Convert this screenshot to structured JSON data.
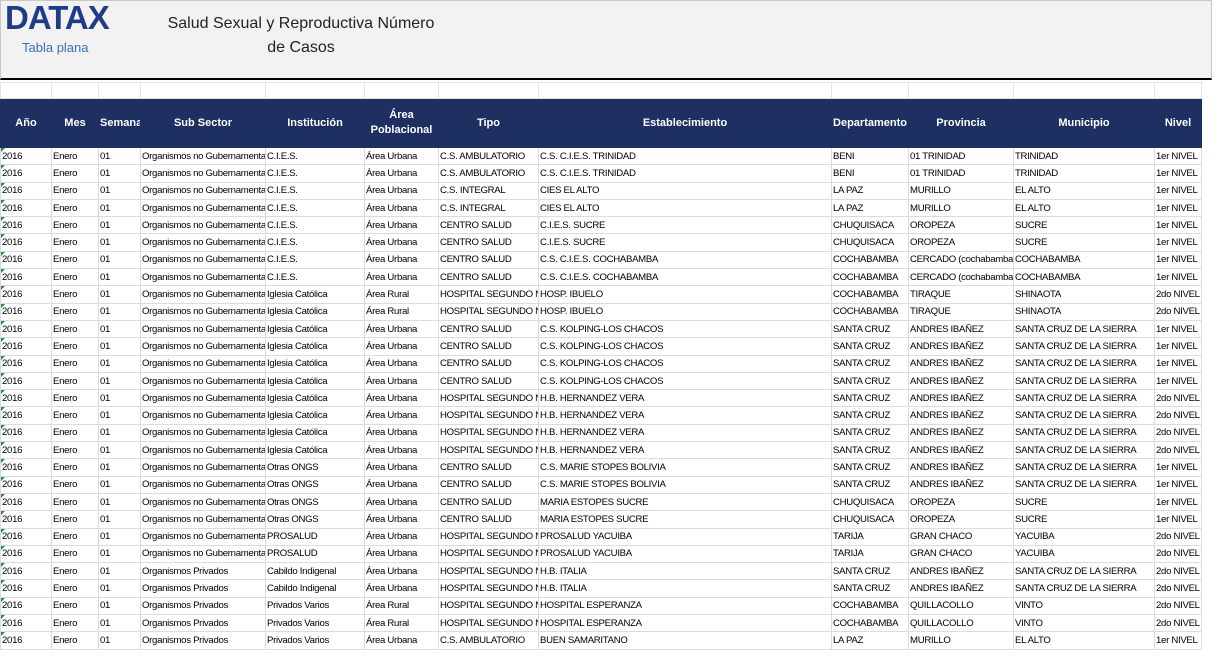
{
  "header": {
    "logo": "DATAX",
    "logo_subtitle": "Tabla plana",
    "title_line1": "Salud Sexual y Reproductiva Número",
    "title_line2": "de Casos"
  },
  "table": {
    "columns": [
      "Año",
      "Mes",
      "Semana",
      "Sub Sector",
      "Institución",
      "Área Poblacional",
      "Tipo",
      "Establecimiento",
      "Departamento",
      "Provincia",
      "Municipio",
      "Nivel"
    ],
    "rows": [
      [
        "2016",
        "Enero",
        "01",
        "Organismos no Gubernamentales",
        "C.I.E.S.",
        "Área Urbana",
        "C.S. AMBULATORIO",
        "C.S. C.I.E.S. TRINIDAD",
        "BENI",
        "01 TRINIDAD",
        "TRINIDAD",
        "1er NIVEL"
      ],
      [
        "2016",
        "Enero",
        "01",
        "Organismos no Gubernamentales",
        "C.I.E.S.",
        "Área Urbana",
        "C.S. AMBULATORIO",
        "C.S. C.I.E.S. TRINIDAD",
        "BENI",
        "01 TRINIDAD",
        "TRINIDAD",
        "1er NIVEL"
      ],
      [
        "2016",
        "Enero",
        "01",
        "Organismos no Gubernamentales",
        "C.I.E.S.",
        "Área Urbana",
        "C.S. INTEGRAL",
        "CIES EL ALTO",
        "LA PAZ",
        "MURILLO",
        "EL ALTO",
        "1er NIVEL"
      ],
      [
        "2016",
        "Enero",
        "01",
        "Organismos no Gubernamentales",
        "C.I.E.S.",
        "Área Urbana",
        "C.S. INTEGRAL",
        "CIES EL ALTO",
        "LA PAZ",
        "MURILLO",
        "EL ALTO",
        "1er NIVEL"
      ],
      [
        "2016",
        "Enero",
        "01",
        "Organismos no Gubernamentales",
        "C.I.E.S.",
        "Área Urbana",
        "CENTRO SALUD",
        "C.I.E.S. SUCRE",
        "CHUQUISACA",
        "OROPEZA",
        "SUCRE",
        "1er NIVEL"
      ],
      [
        "2016",
        "Enero",
        "01",
        "Organismos no Gubernamentales",
        "C.I.E.S.",
        "Área Urbana",
        "CENTRO SALUD",
        "C.I.E.S. SUCRE",
        "CHUQUISACA",
        "OROPEZA",
        "SUCRE",
        "1er NIVEL"
      ],
      [
        "2016",
        "Enero",
        "01",
        "Organismos no Gubernamentales",
        "C.I.E.S.",
        "Área Urbana",
        "CENTRO SALUD",
        "C.S. C.I.E.S. COCHABAMBA",
        "COCHABAMBA",
        "CERCADO (cochabamba)",
        "COCHABAMBA",
        "1er NIVEL"
      ],
      [
        "2016",
        "Enero",
        "01",
        "Organismos no Gubernamentales",
        "C.I.E.S.",
        "Área Urbana",
        "CENTRO SALUD",
        "C.S. C.I.E.S. COCHABAMBA",
        "COCHABAMBA",
        "CERCADO (cochabamba)",
        "COCHABAMBA",
        "1er NIVEL"
      ],
      [
        "2016",
        "Enero",
        "01",
        "Organismos no Gubernamentales",
        "Iglesia Católica",
        "Área Rural",
        "HOSPITAL SEGUNDO NIVEL",
        "HOSP. IBUELO",
        "COCHABAMBA",
        "TIRAQUE",
        "SHINAOTA",
        "2do NIVEL"
      ],
      [
        "2016",
        "Enero",
        "01",
        "Organismos no Gubernamentales",
        "Iglesia Católica",
        "Área Rural",
        "HOSPITAL SEGUNDO NIVEL",
        "HOSP. IBUELO",
        "COCHABAMBA",
        "TIRAQUE",
        "SHINAOTA",
        "2do NIVEL"
      ],
      [
        "2016",
        "Enero",
        "01",
        "Organismos no Gubernamentales",
        "Iglesia Católica",
        "Área Urbana",
        "CENTRO SALUD",
        "C.S. KOLPING-LOS CHACOS",
        "SANTA CRUZ",
        "ANDRES IBAÑEZ",
        "SANTA CRUZ DE LA SIERRA",
        "1er NIVEL"
      ],
      [
        "2016",
        "Enero",
        "01",
        "Organismos no Gubernamentales",
        "Iglesia Católica",
        "Área Urbana",
        "CENTRO SALUD",
        "C.S. KOLPING-LOS CHACOS",
        "SANTA CRUZ",
        "ANDRES IBAÑEZ",
        "SANTA CRUZ DE LA SIERRA",
        "1er NIVEL"
      ],
      [
        "2016",
        "Enero",
        "01",
        "Organismos no Gubernamentales",
        "Iglesia Católica",
        "Área Urbana",
        "CENTRO SALUD",
        "C.S. KOLPING-LOS CHACOS",
        "SANTA CRUZ",
        "ANDRES IBAÑEZ",
        "SANTA CRUZ DE LA SIERRA",
        "1er NIVEL"
      ],
      [
        "2016",
        "Enero",
        "01",
        "Organismos no Gubernamentales",
        "Iglesia Católica",
        "Área Urbana",
        "CENTRO SALUD",
        "C.S. KOLPING-LOS CHACOS",
        "SANTA CRUZ",
        "ANDRES IBAÑEZ",
        "SANTA CRUZ DE LA SIERRA",
        "1er NIVEL"
      ],
      [
        "2016",
        "Enero",
        "01",
        "Organismos no Gubernamentales",
        "Iglesia Católica",
        "Área Urbana",
        "HOSPITAL SEGUNDO NIVEL",
        "H.B. HERNANDEZ VERA",
        "SANTA CRUZ",
        "ANDRES IBAÑEZ",
        "SANTA CRUZ DE LA SIERRA",
        "2do NIVEL"
      ],
      [
        "2016",
        "Enero",
        "01",
        "Organismos no Gubernamentales",
        "Iglesia Católica",
        "Área Urbana",
        "HOSPITAL SEGUNDO NIVEL",
        "H.B. HERNANDEZ VERA",
        "SANTA CRUZ",
        "ANDRES IBAÑEZ",
        "SANTA CRUZ DE LA SIERRA",
        "2do NIVEL"
      ],
      [
        "2016",
        "Enero",
        "01",
        "Organismos no Gubernamentales",
        "Iglesia Católica",
        "Área Urbana",
        "HOSPITAL SEGUNDO NIVEL",
        "H.B. HERNANDEZ VERA",
        "SANTA CRUZ",
        "ANDRES IBAÑEZ",
        "SANTA CRUZ DE LA SIERRA",
        "2do NIVEL"
      ],
      [
        "2016",
        "Enero",
        "01",
        "Organismos no Gubernamentales",
        "Iglesia Católica",
        "Área Urbana",
        "HOSPITAL SEGUNDO NIVEL",
        "H.B. HERNANDEZ VERA",
        "SANTA CRUZ",
        "ANDRES IBAÑEZ",
        "SANTA CRUZ DE LA SIERRA",
        "2do NIVEL"
      ],
      [
        "2016",
        "Enero",
        "01",
        "Organismos no Gubernamentales",
        "Otras ONGS",
        "Área Urbana",
        "CENTRO SALUD",
        "C.S. MARIE STOPES BOLIVIA",
        "SANTA CRUZ",
        "ANDRES IBAÑEZ",
        "SANTA CRUZ DE LA SIERRA",
        "1er NIVEL"
      ],
      [
        "2016",
        "Enero",
        "01",
        "Organismos no Gubernamentales",
        "Otras ONGS",
        "Área Urbana",
        "CENTRO SALUD",
        "C.S. MARIE STOPES BOLIVIA",
        "SANTA CRUZ",
        "ANDRES IBAÑEZ",
        "SANTA CRUZ DE LA SIERRA",
        "1er NIVEL"
      ],
      [
        "2016",
        "Enero",
        "01",
        "Organismos no Gubernamentales",
        "Otras ONGS",
        "Área Urbana",
        "CENTRO SALUD",
        "MARIA ESTOPES SUCRE",
        "CHUQUISACA",
        "OROPEZA",
        "SUCRE",
        "1er NIVEL"
      ],
      [
        "2016",
        "Enero",
        "01",
        "Organismos no Gubernamentales",
        "Otras ONGS",
        "Área Urbana",
        "CENTRO SALUD",
        "MARIA ESTOPES SUCRE",
        "CHUQUISACA",
        "OROPEZA",
        "SUCRE",
        "1er NIVEL"
      ],
      [
        "2016",
        "Enero",
        "01",
        "Organismos no Gubernamentales",
        "PROSALUD",
        "Área Urbana",
        "HOSPITAL SEGUNDO NIVEL",
        "PROSALUD YACUIBA",
        "TARIJA",
        "GRAN CHACO",
        "YACUIBA",
        "2do NIVEL"
      ],
      [
        "2016",
        "Enero",
        "01",
        "Organismos no Gubernamentales",
        "PROSALUD",
        "Área Urbana",
        "HOSPITAL SEGUNDO NIVEL",
        "PROSALUD YACUIBA",
        "TARIJA",
        "GRAN CHACO",
        "YACUIBA",
        "2do NIVEL"
      ],
      [
        "2016",
        "Enero",
        "01",
        "Organismos Privados",
        "Cabildo Indigenal",
        "Área Urbana",
        "HOSPITAL SEGUNDO NIVEL",
        "H.B. ITALIA",
        "SANTA CRUZ",
        "ANDRES IBAÑEZ",
        "SANTA CRUZ DE LA SIERRA",
        "2do NIVEL"
      ],
      [
        "2016",
        "Enero",
        "01",
        "Organismos Privados",
        "Cabildo Indigenal",
        "Área Urbana",
        "HOSPITAL SEGUNDO NIVEL",
        "H.B. ITALIA",
        "SANTA CRUZ",
        "ANDRES IBAÑEZ",
        "SANTA CRUZ DE LA SIERRA",
        "2do NIVEL"
      ],
      [
        "2016",
        "Enero",
        "01",
        "Organismos Privados",
        "Privados Varios",
        "Área Rural",
        "HOSPITAL SEGUNDO NIVEL",
        "HOSPITAL ESPERANZA",
        "COCHABAMBA",
        "QUILLACOLLO",
        "VINTO",
        "2do NIVEL"
      ],
      [
        "2016",
        "Enero",
        "01",
        "Organismos Privados",
        "Privados Varios",
        "Área Rural",
        "HOSPITAL SEGUNDO NIVEL",
        "HOSPITAL ESPERANZA",
        "COCHABAMBA",
        "QUILLACOLLO",
        "VINTO",
        "2do NIVEL"
      ],
      [
        "2016",
        "Enero",
        "01",
        "Organismos Privados",
        "Privados Varios",
        "Área Urbana",
        "C.S. AMBULATORIO",
        "BUEN SAMARITANO",
        "LA PAZ",
        "MURILLO",
        "EL ALTO",
        "1er NIVEL"
      ]
    ]
  }
}
